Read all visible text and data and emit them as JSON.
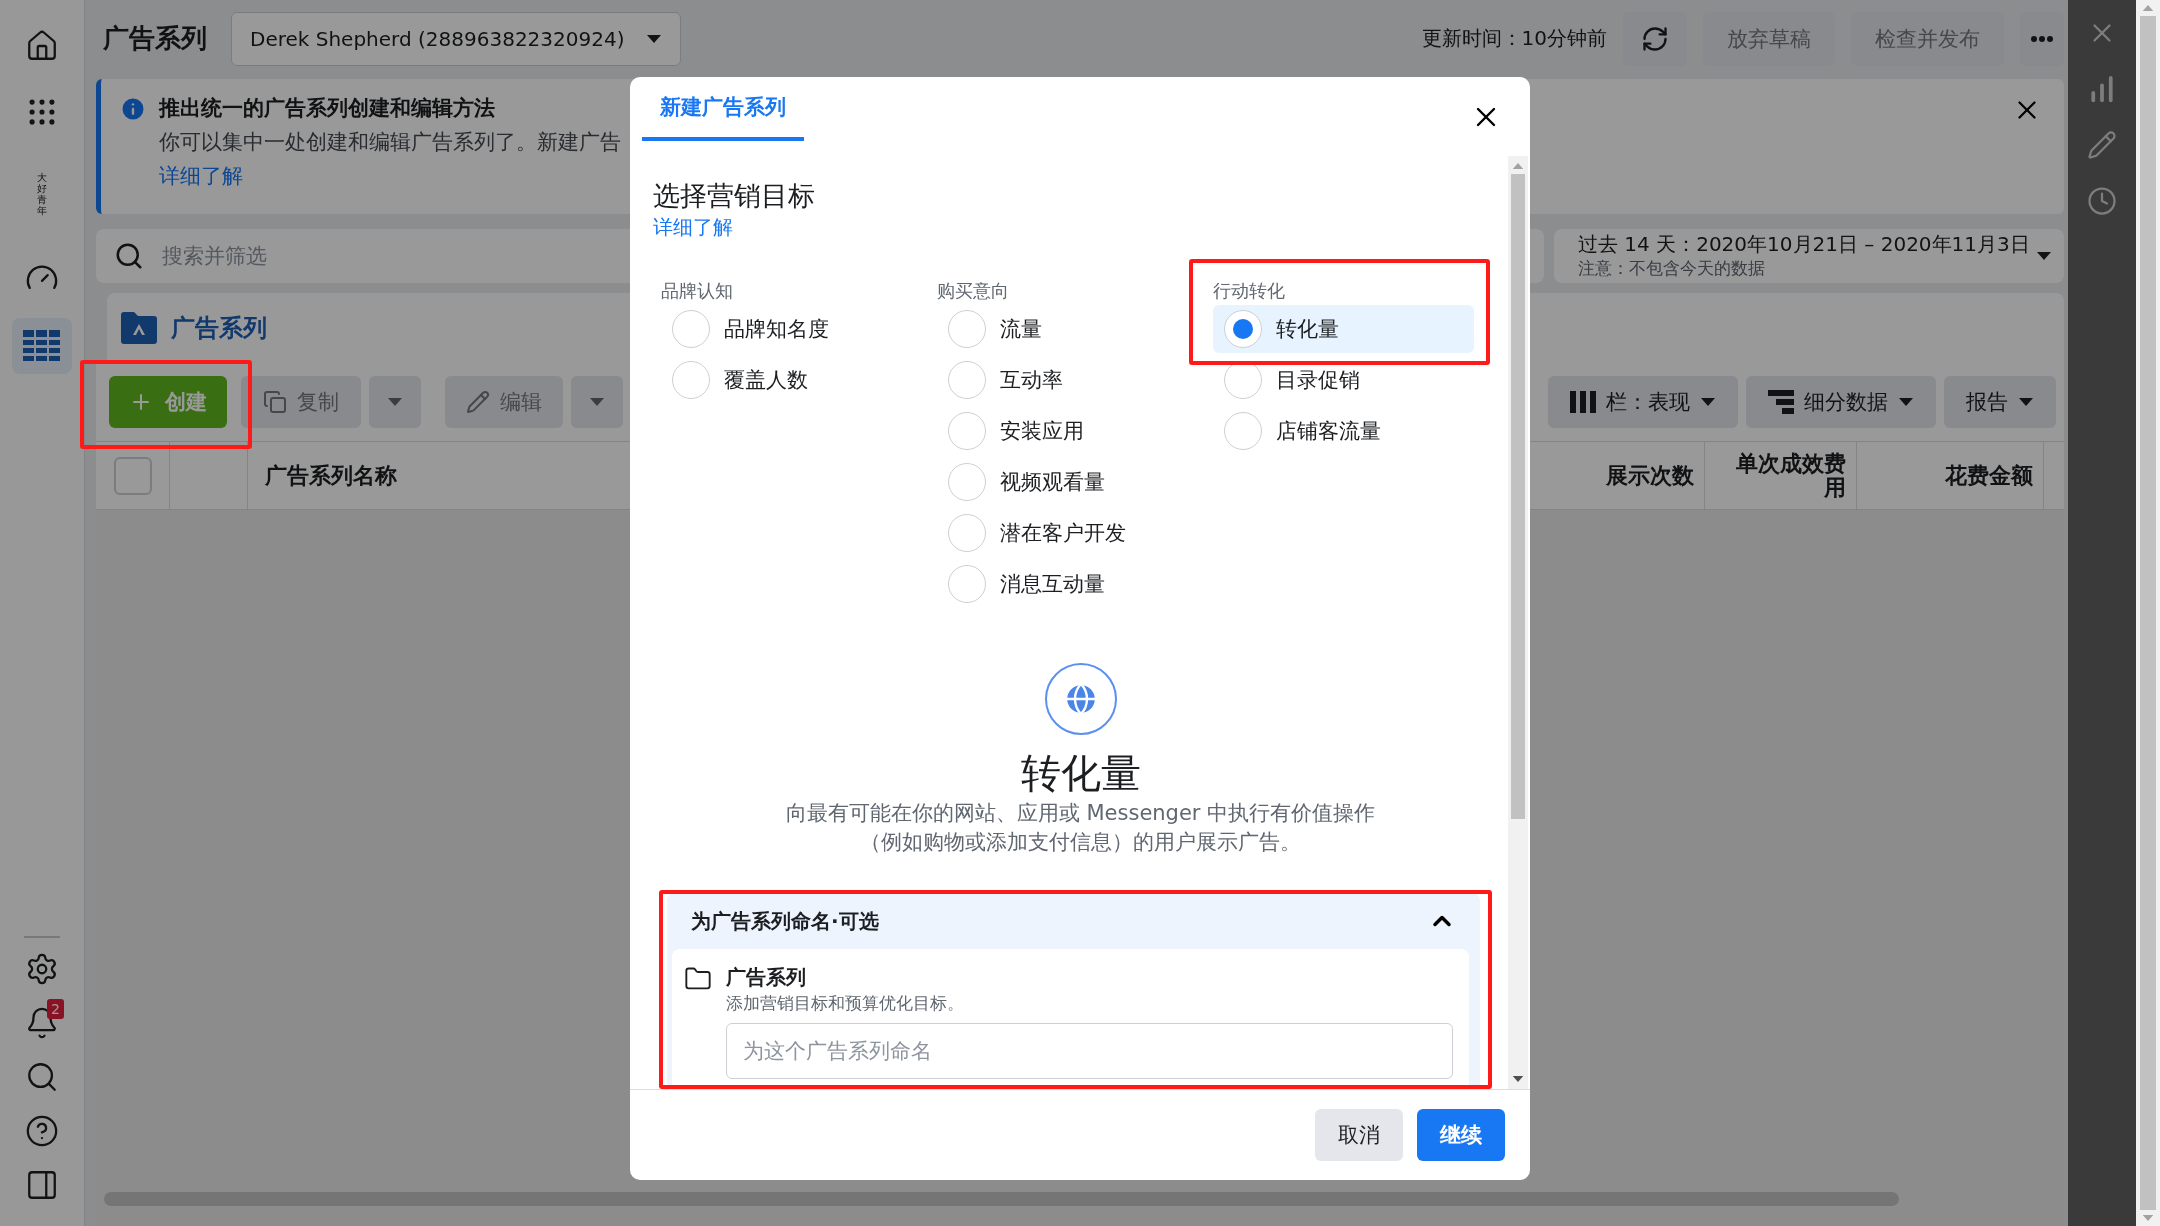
{
  "sidebar": {
    "top": [
      {
        "kind": "home",
        "selected": false
      },
      {
        "kind": "apps",
        "selected": false
      },
      {
        "kind": "logo",
        "label": "大好青年",
        "selected": false
      },
      {
        "kind": "dashboard",
        "selected": false
      },
      {
        "kind": "table",
        "selected": true
      }
    ],
    "bottom": [
      {
        "kind": "settings",
        "selected": false
      },
      {
        "kind": "notifications",
        "badge": "2",
        "selected": false
      },
      {
        "kind": "search",
        "selected": false
      },
      {
        "kind": "help",
        "selected": false
      },
      {
        "kind": "panel",
        "selected": false
      }
    ]
  },
  "header": {
    "title": "广告系列",
    "account": "Derek Shepherd (288963822320924)",
    "updated": "更新时间：10分钟前",
    "buttons": [
      {
        "label": "放弃草稿",
        "disabled": true
      },
      {
        "label": "检查并发布",
        "disabled": true
      }
    ]
  },
  "banner": {
    "title": "推出统一的广告系列创建和编辑方法",
    "text": "你可以集中一处创建和编辑广告系列了。新建广告",
    "link": "详细了解"
  },
  "search": {
    "placeholder": "搜索并筛选"
  },
  "date_range": {
    "range": "过去 14 天：2020年10月21日 – 2020年11月3日",
    "note": "注意：不包含今天的数据"
  },
  "campaigns": {
    "title": "广告系列",
    "toolbar": [
      {
        "kind": "create",
        "label": "创建"
      },
      {
        "kind": "copy",
        "label": "复制",
        "disabled": true
      },
      {
        "kind": "edit",
        "label": "编辑",
        "disabled": true
      }
    ],
    "view_buttons": [
      {
        "kind": "columns",
        "label": "栏：表现"
      },
      {
        "kind": "breakdown",
        "label": "细分数据"
      },
      {
        "kind": "plain",
        "label": "报告"
      }
    ],
    "select_all": {
      "checked": false
    },
    "columns": [
      {
        "label": "广告系列名称"
      },
      {
        "label": "展示次数"
      },
      {
        "label": "单次成效费用"
      },
      {
        "label": "花费金额"
      }
    ]
  },
  "right_panel": [
    {
      "kind": "close"
    },
    {
      "kind": "chart"
    },
    {
      "kind": "edit"
    },
    {
      "kind": "history"
    }
  ],
  "modal": {
    "tab": {
      "label": "新建广告系列",
      "selected": true
    },
    "heading": "选择营销目标",
    "link": "详细了解",
    "groups": [
      {
        "label": "品牌认知",
        "options": [
          {
            "label": "品牌知名度",
            "selected": false
          },
          {
            "label": "覆盖人数",
            "selected": false
          }
        ]
      },
      {
        "label": "购买意向",
        "options": [
          {
            "label": "流量",
            "selected": false
          },
          {
            "label": "互动率",
            "selected": false
          },
          {
            "label": "安装应用",
            "selected": false
          },
          {
            "label": "视频观看量",
            "selected": false
          },
          {
            "label": "潜在客户开发",
            "selected": false
          },
          {
            "label": "消息互动量",
            "selected": false
          }
        ]
      },
      {
        "label": "行动转化",
        "options": [
          {
            "label": "转化量",
            "selected": true
          },
          {
            "label": "目录促销",
            "selected": false
          },
          {
            "label": "店铺客流量",
            "selected": false
          }
        ]
      }
    ],
    "detail": {
      "title": "转化量",
      "description": "向最有可能在你的网站、应用或 Messenger 中执行有价值操作（例如购物或添加支付信息）的用户展示广告。"
    },
    "naming": {
      "title": "为广告系列命名·可选",
      "expanded": true,
      "item_title": "广告系列",
      "item_hint": "添加营销目标和预算优化目标。",
      "placeholder": "为这个广告系列命名"
    },
    "buttons": [
      {
        "kind": "secondary",
        "label": "取消"
      },
      {
        "kind": "primary",
        "label": "继续"
      }
    ]
  }
}
